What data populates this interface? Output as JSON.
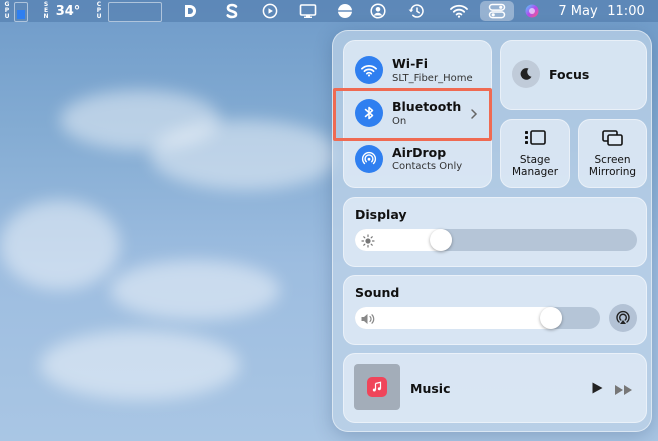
{
  "menubar": {
    "gpu_label": "GPU",
    "sensor_label": "SEN",
    "temperature": "34°",
    "cpu_label": "CPU",
    "date": "7 May",
    "time": "11:00"
  },
  "control_center": {
    "wifi": {
      "title": "Wi-Fi",
      "network": "SLT_Fiber_Home"
    },
    "bluetooth": {
      "title": "Bluetooth",
      "status": "On"
    },
    "airdrop": {
      "title": "AirDrop",
      "status": "Contacts Only"
    },
    "focus": {
      "title": "Focus"
    },
    "stage_manager": {
      "line1": "Stage",
      "line2": "Manager"
    },
    "screen_mirroring": {
      "line1": "Screen",
      "line2": "Mirroring"
    },
    "display": {
      "title": "Display",
      "level": 0.29
    },
    "sound": {
      "title": "Sound",
      "level": 0.83
    },
    "music": {
      "title": "Music"
    }
  },
  "colors": {
    "accent_blue": "#2f7ff0",
    "highlight": "#ef6a52",
    "music_icon": "#f0455a"
  }
}
